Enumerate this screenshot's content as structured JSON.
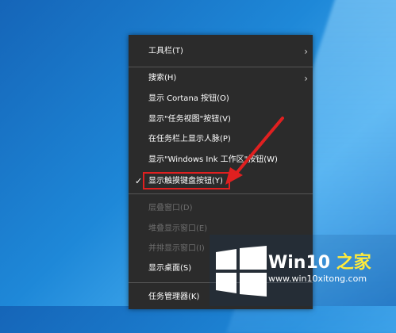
{
  "menu": {
    "items": [
      {
        "label": "工具栏(T)"
      },
      {
        "label": "搜索(H)"
      },
      {
        "label": "显示 Cortana 按钮(O)"
      },
      {
        "label": "显示\"任务视图\"按钮(V)"
      },
      {
        "label": "在任务栏上显示人脉(P)"
      },
      {
        "label": "显示\"Windows Ink 工作区\"按钮(W)"
      },
      {
        "label": "显示触摸键盘按钮(Y)",
        "checked": true
      },
      {
        "label": "层叠窗口(D)",
        "disabled": true
      },
      {
        "label": "堆叠显示窗口(E)",
        "disabled": true
      },
      {
        "label": "并排显示窗口(I)",
        "disabled": true
      },
      {
        "label": "显示桌面(S)"
      },
      {
        "label": "任务管理器(K)"
      }
    ],
    "submenu_arrow": "›",
    "check_mark": "✓"
  },
  "watermark": {
    "brand_main": "Win10",
    "brand_accent": " 之家",
    "site": "www.win10xitong.com"
  },
  "colors": {
    "menu_bg": "#2b2b2b",
    "highlight": "#e02020",
    "logo_blue": "#1e88e5"
  }
}
